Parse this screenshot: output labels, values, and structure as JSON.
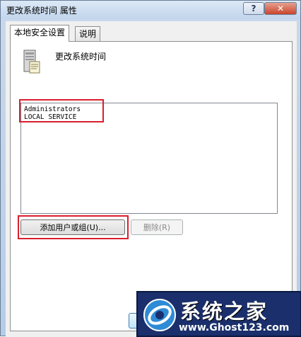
{
  "window": {
    "title": "更改系统时间 属性",
    "help_label": "?",
    "close_label": "✕"
  },
  "tabs": [
    {
      "label": "本地安全设置",
      "active": true
    },
    {
      "label": "说明",
      "active": false
    }
  ],
  "policy": {
    "title": "更改系统时间",
    "icon": "server-policy-icon"
  },
  "accounts": {
    "items": [
      "Administrators",
      "LOCAL SERVICE"
    ]
  },
  "buttons": {
    "add_label": "添加用户或组(U)...",
    "remove_label": "删除(R)"
  },
  "watermark": {
    "title": "系统之家",
    "url": "www.Ghost123.com"
  },
  "colors": {
    "highlight": "#d91f2e",
    "watermark_bg": "#1a2f6b"
  }
}
